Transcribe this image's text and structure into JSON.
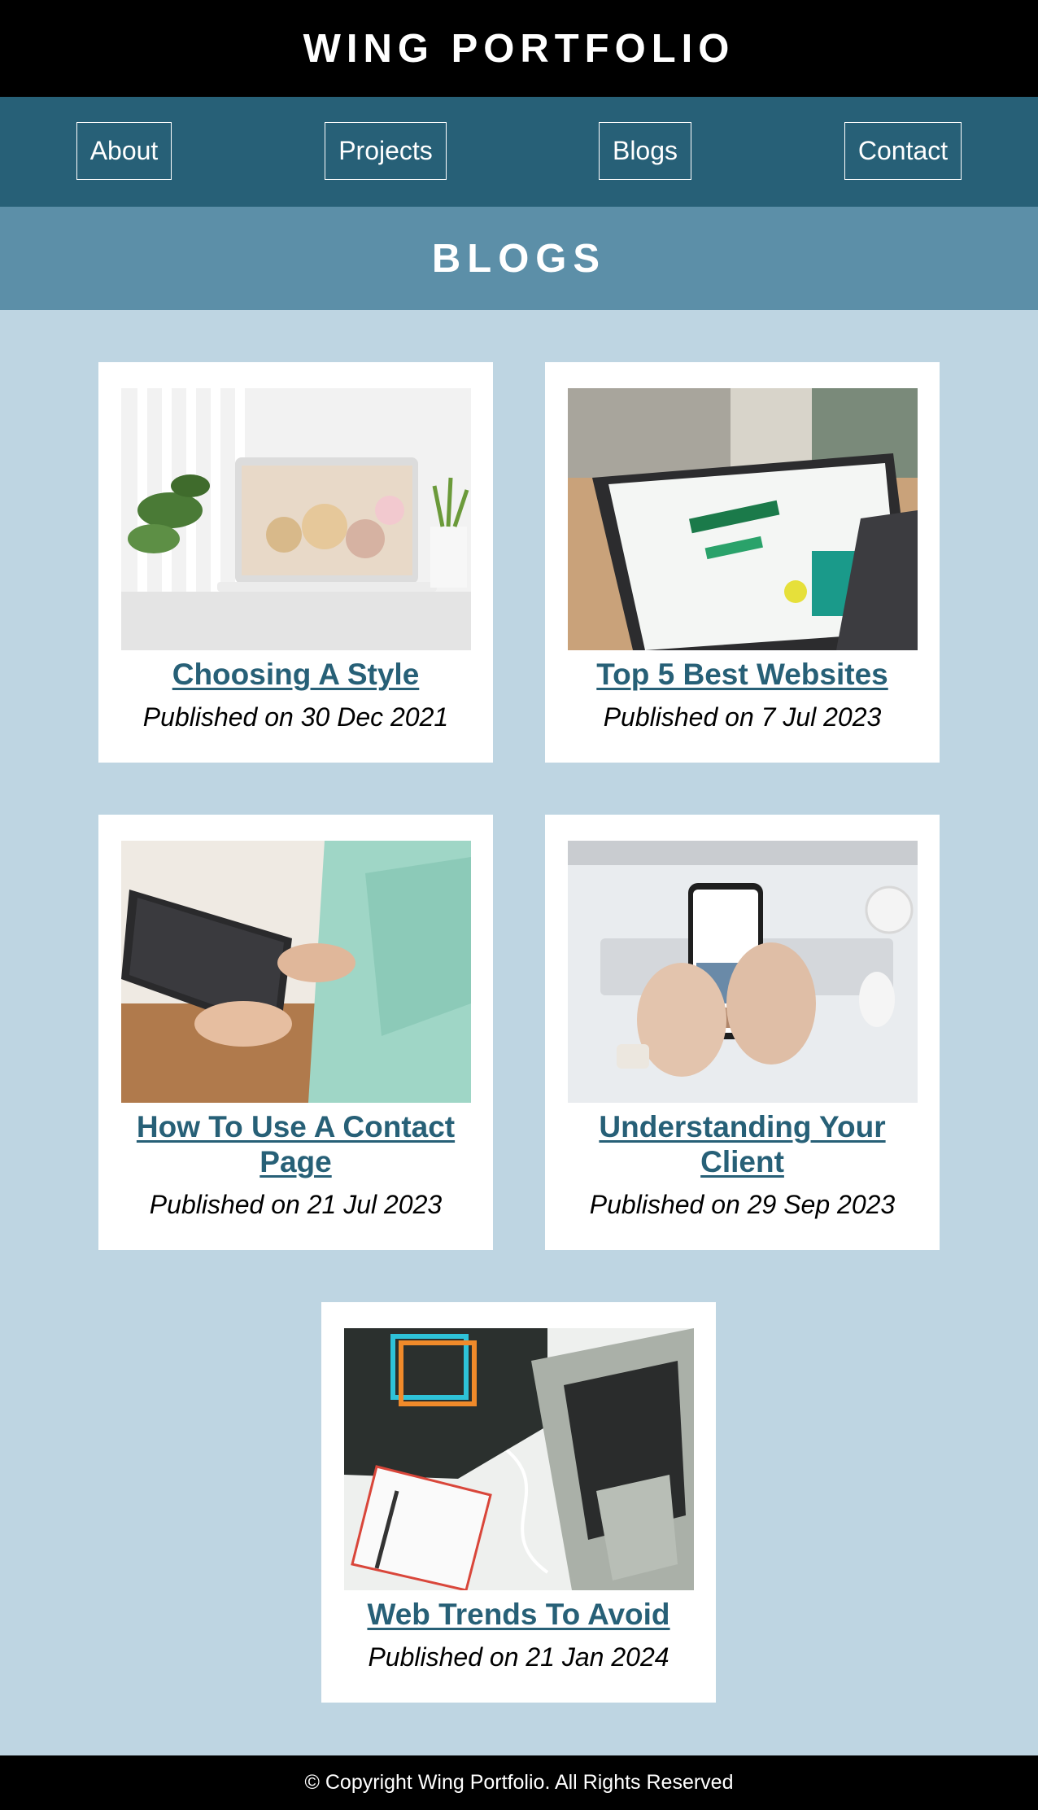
{
  "header": {
    "title": "WING PORTFOLIO"
  },
  "nav": {
    "items": [
      {
        "label": "About"
      },
      {
        "label": "Projects"
      },
      {
        "label": "Blogs"
      },
      {
        "label": "Contact"
      }
    ]
  },
  "section": {
    "heading": "BLOGS"
  },
  "blogs": [
    {
      "title": "Choosing A Style",
      "date": "Published on 30 Dec 2021",
      "image": "laptop-with-plants-photo"
    },
    {
      "title": "Top 5 Best Websites",
      "date": "Published on 7 Jul 2023",
      "image": "laptop-shopify-screen-photo"
    },
    {
      "title": "How To Use A Contact Page",
      "date": "Published on 21 Jul 2023",
      "image": "person-holding-tablet-photo"
    },
    {
      "title": "Understanding Your Client",
      "date": "Published on 29 Sep 2023",
      "image": "hands-holding-smartphone-photo"
    },
    {
      "title": "Web Trends To Avoid",
      "date": "Published on 21 Jan 2024",
      "image": "html-css-book-and-laptop-photo"
    }
  ],
  "footer": {
    "text": "© Copyright Wing Portfolio. All Rights Reserved"
  },
  "colors": {
    "header_bg": "#000000",
    "nav_bg": "#276077",
    "section_bg": "#5c8fa8",
    "page_bg": "#bed5e2",
    "link": "#276077"
  }
}
